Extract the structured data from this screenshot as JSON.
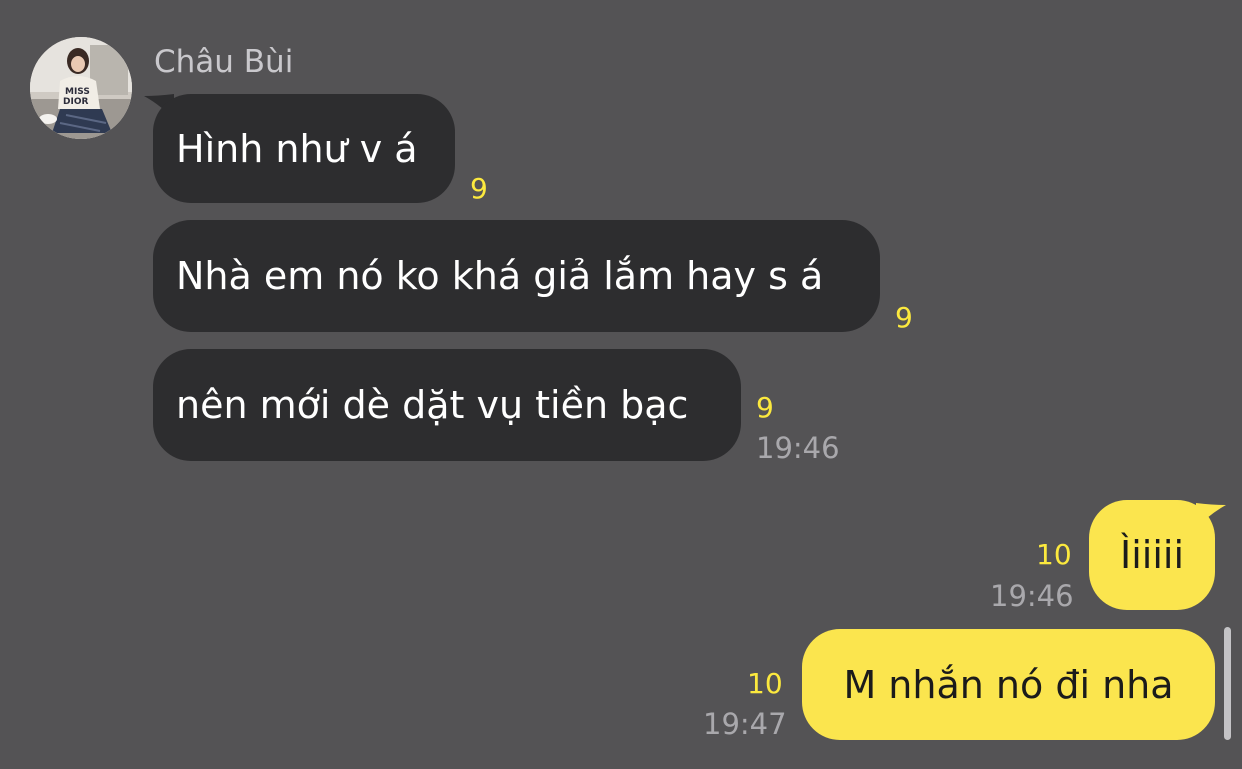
{
  "chat": {
    "sender_name": "Châu Bùi",
    "incoming": [
      {
        "text": "Hình như v á",
        "unread": "9"
      },
      {
        "text": "Nhà em nó ko khá giả lắm hay s á",
        "unread": "9"
      },
      {
        "text": "nên mới dè dặt vụ tiền bạc",
        "unread": "9",
        "time": "19:46"
      }
    ],
    "outgoing": [
      {
        "text": "Ìiiiii",
        "unread": "10",
        "time": "19:46"
      },
      {
        "text": "M nhắn nó đi nha",
        "unread": "10",
        "time": "19:47"
      }
    ]
  },
  "colors": {
    "background": "#545355",
    "incoming_bubble": "#2d2d2f",
    "outgoing_bubble": "#fbe54e",
    "unread_count": "#fce93e"
  }
}
